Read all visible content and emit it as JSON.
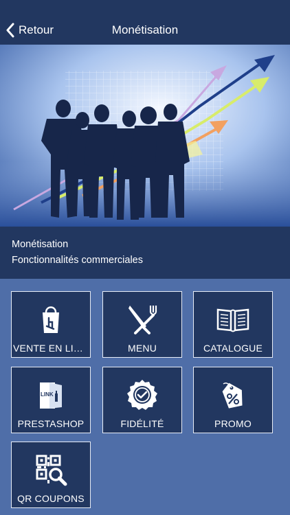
{
  "navbar": {
    "back_label": "Retour",
    "title": "Monétisation"
  },
  "info": {
    "title": "Monétisation",
    "subtitle": "Fonctionnalités commerciales"
  },
  "tiles": [
    {
      "label": "VENTE EN LIG…",
      "icon": "shopping-bag-icon"
    },
    {
      "label": "MENU",
      "icon": "knife-fork-icon"
    },
    {
      "label": "CATALOGUE",
      "icon": "open-book-icon"
    },
    {
      "label": "PRESTASHOP",
      "icon": "link-door-icon"
    },
    {
      "label": "FIDÉLITÉ",
      "icon": "badge-check-icon"
    },
    {
      "label": "PROMO",
      "icon": "percent-tag-icon"
    },
    {
      "label": "QR COUPONS",
      "icon": "qr-search-icon"
    }
  ],
  "colors": {
    "navbar": "#223760",
    "background": "#4f6ea8",
    "tile": "#223760",
    "text": "#ffffff"
  }
}
